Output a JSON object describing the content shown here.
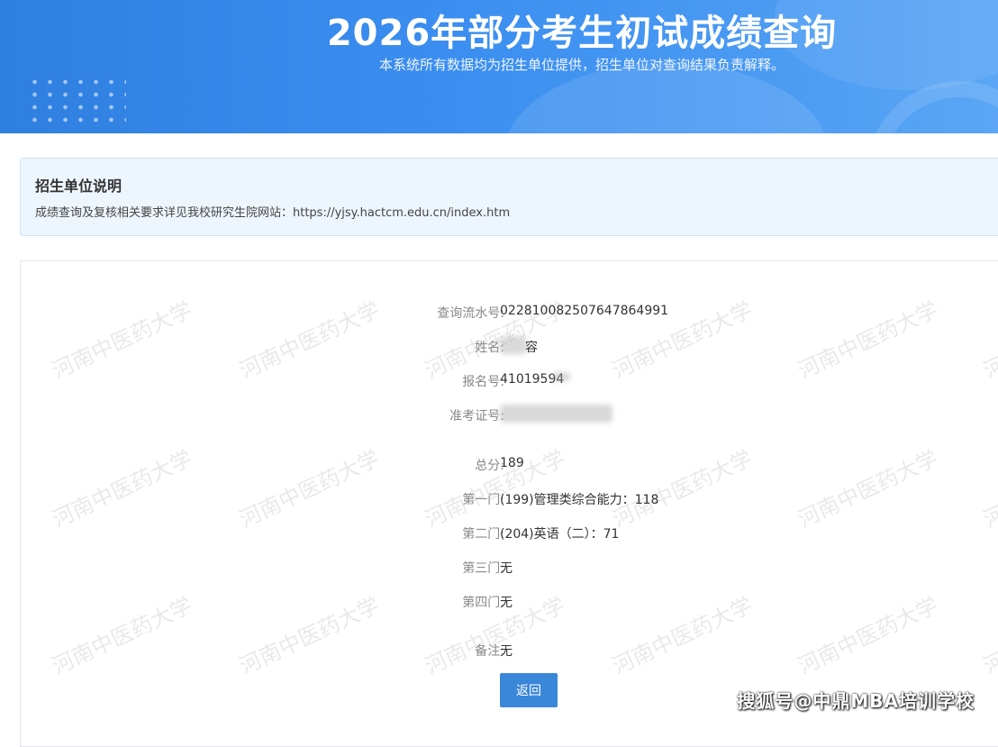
{
  "header": {
    "title": "2026年部分考生初试成绩查询",
    "subtitle": "本系统所有数据均为招生单位提供，招生单位对查询结果负责解释。"
  },
  "notice": {
    "title": "招生单位说明",
    "body": "成绩查询及复核相关要求详见我校研究生院网站：https://yjsy.hactcm.edu.cn/index.htm"
  },
  "watermark_text": "河南中医药大学",
  "result": {
    "serial": {
      "label": "查询流水号:",
      "value": "022810082507647864991"
    },
    "name": {
      "label": "姓名:",
      "value": "容"
    },
    "registration": {
      "label": "报名号:",
      "value": "41019594"
    },
    "admission_ticket": {
      "label": "准考证号:",
      "value": ""
    },
    "total": {
      "label": "总分:",
      "value": "189"
    },
    "subject1": {
      "label": "第一门:",
      "value": "(199)管理类综合能力：118"
    },
    "subject2": {
      "label": "第二门:",
      "value": "(204)英语（二）：71"
    },
    "subject3": {
      "label": "第三门:",
      "value": "无"
    },
    "subject4": {
      "label": "第四门:",
      "value": "无"
    },
    "remark": {
      "label": "备注:",
      "value": "无"
    }
  },
  "actions": {
    "back_label": "返回"
  },
  "site_watermark": "搜狐号@中鼎MBA培训学校",
  "colors": {
    "banner": "#3b8ef0",
    "notice_bg": "#eef6fd",
    "button": "#3a86d8"
  }
}
